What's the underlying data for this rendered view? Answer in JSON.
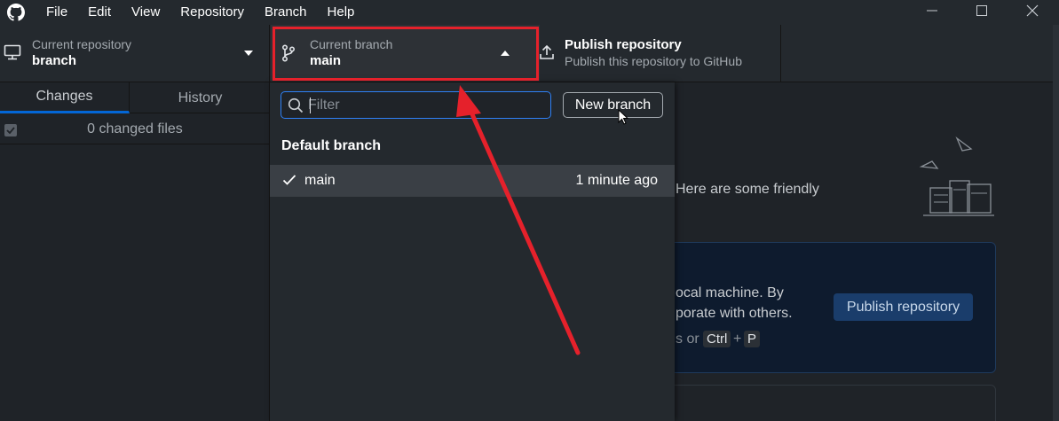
{
  "menu": {
    "items": [
      "File",
      "Edit",
      "View",
      "Repository",
      "Branch",
      "Help"
    ]
  },
  "toolbar": {
    "repository": {
      "label": "Current repository",
      "value": "branch"
    },
    "branch": {
      "label": "Current branch",
      "value": "main"
    },
    "publish": {
      "title": "Publish repository",
      "subtitle": "Publish this repository to GitHub"
    }
  },
  "sidebar": {
    "tabs": [
      "Changes",
      "History"
    ],
    "changed_files": "0 changed files"
  },
  "dropdown": {
    "filter_placeholder": "Filter",
    "new_branch_label": "New branch",
    "section_header": "Default branch",
    "branches": [
      {
        "name": "main",
        "time": "1 minute ago",
        "selected": true
      }
    ]
  },
  "main": {
    "welcome_partial": "Here are some friendly",
    "card_lines": [
      "ocal machine. By",
      "porate with others.",
      "s or"
    ],
    "shortcut_keys": [
      "Ctrl",
      "P"
    ],
    "shortcut_plus": "+",
    "card_button_label": "Publish repository"
  },
  "colors": {
    "accent": "#0366d6",
    "highlight": "#e5212b",
    "focus": "#2f81f7"
  },
  "icons": [
    "github-logo-icon",
    "minimize-icon",
    "maximize-icon",
    "close-icon",
    "computer-icon",
    "caret-down-icon",
    "git-branch-icon",
    "caret-up-icon",
    "upload-icon",
    "search-icon",
    "check-icon",
    "checkbox-icon",
    "cursor-icon"
  ]
}
